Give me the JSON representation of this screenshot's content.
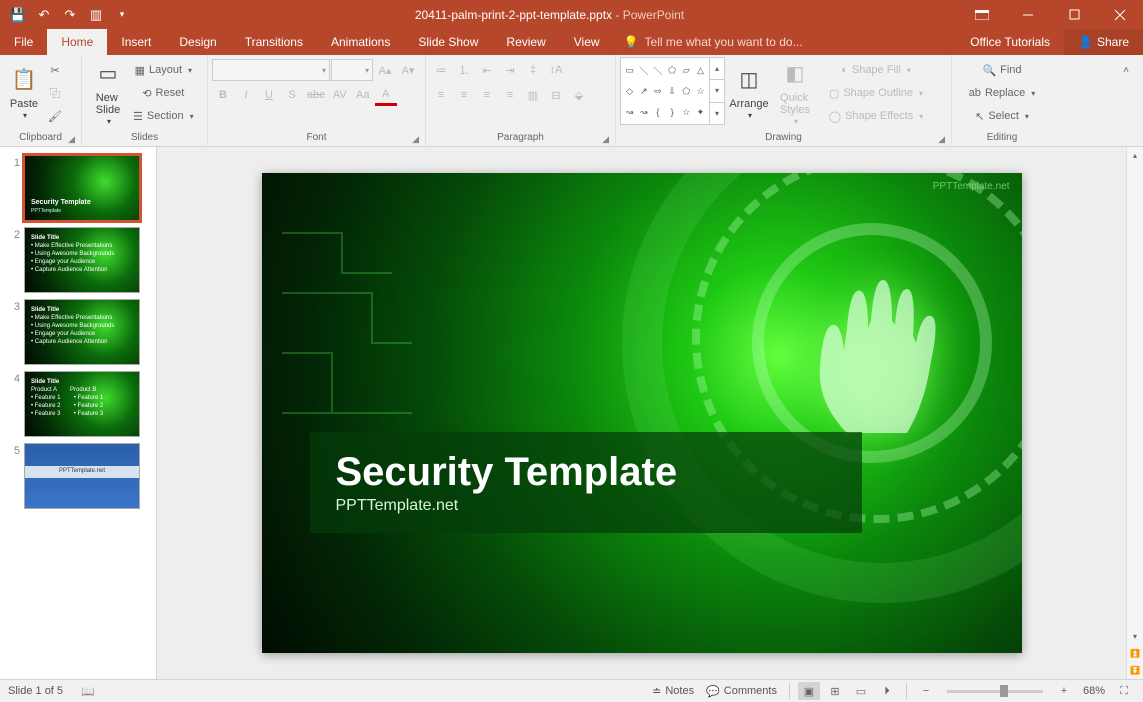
{
  "titlebar": {
    "filename": "20411-palm-print-2-ppt-template.pptx",
    "app": "PowerPoint"
  },
  "tabs": {
    "file": "File",
    "home": "Home",
    "insert": "Insert",
    "design": "Design",
    "transitions": "Transitions",
    "animations": "Animations",
    "slideshow": "Slide Show",
    "review": "Review",
    "view": "View",
    "tellme_placeholder": "Tell me what you want to do...",
    "tutorials": "Office Tutorials",
    "share": "Share"
  },
  "ribbon": {
    "clipboard": {
      "paste": "Paste",
      "cut": "Cut",
      "copy": "Copy",
      "formatpainter": "Format Painter",
      "label": "Clipboard"
    },
    "slides": {
      "newslide": "New\nSlide",
      "layout": "Layout",
      "reset": "Reset",
      "section": "Section",
      "label": "Slides"
    },
    "font": {
      "label": "Font"
    },
    "paragraph": {
      "label": "Paragraph"
    },
    "drawing": {
      "arrange": "Arrange",
      "quick": "Quick\nStyles",
      "fill": "Shape Fill",
      "outline": "Shape Outline",
      "effects": "Shape Effects",
      "label": "Drawing"
    },
    "editing": {
      "find": "Find",
      "replace": "Replace",
      "select": "Select",
      "label": "Editing"
    }
  },
  "slide": {
    "title": "Security Template",
    "subtitle": "PPTTemplate.net",
    "watermark": "PPTTemplate.net"
  },
  "thumbs": [
    {
      "n": "1",
      "title": "Security Template",
      "sub": "PPTTemplate"
    },
    {
      "n": "2",
      "title": "Slide Title",
      "body": "• Make Effective Presentations\n• Using Awesome Backgrounds\n• Engage your Audience\n• Capture Audience Attention"
    },
    {
      "n": "3",
      "title": "Slide Title",
      "body": "• Make Effective Presentations\n• Using Awesome Backgrounds\n• Engage your Audience\n• Capture Audience Attention"
    },
    {
      "n": "4",
      "title": "Slide Title",
      "body": "Product A        Product B\n• Feature 1        • Feature 1\n• Feature 2        • Feature 2\n• Feature 3        • Feature 3"
    },
    {
      "n": "5",
      "title": "PPTTemplate.net"
    }
  ],
  "status": {
    "slide": "Slide 1 of 5",
    "notes": "Notes",
    "comments": "Comments",
    "zoom": "68%"
  }
}
